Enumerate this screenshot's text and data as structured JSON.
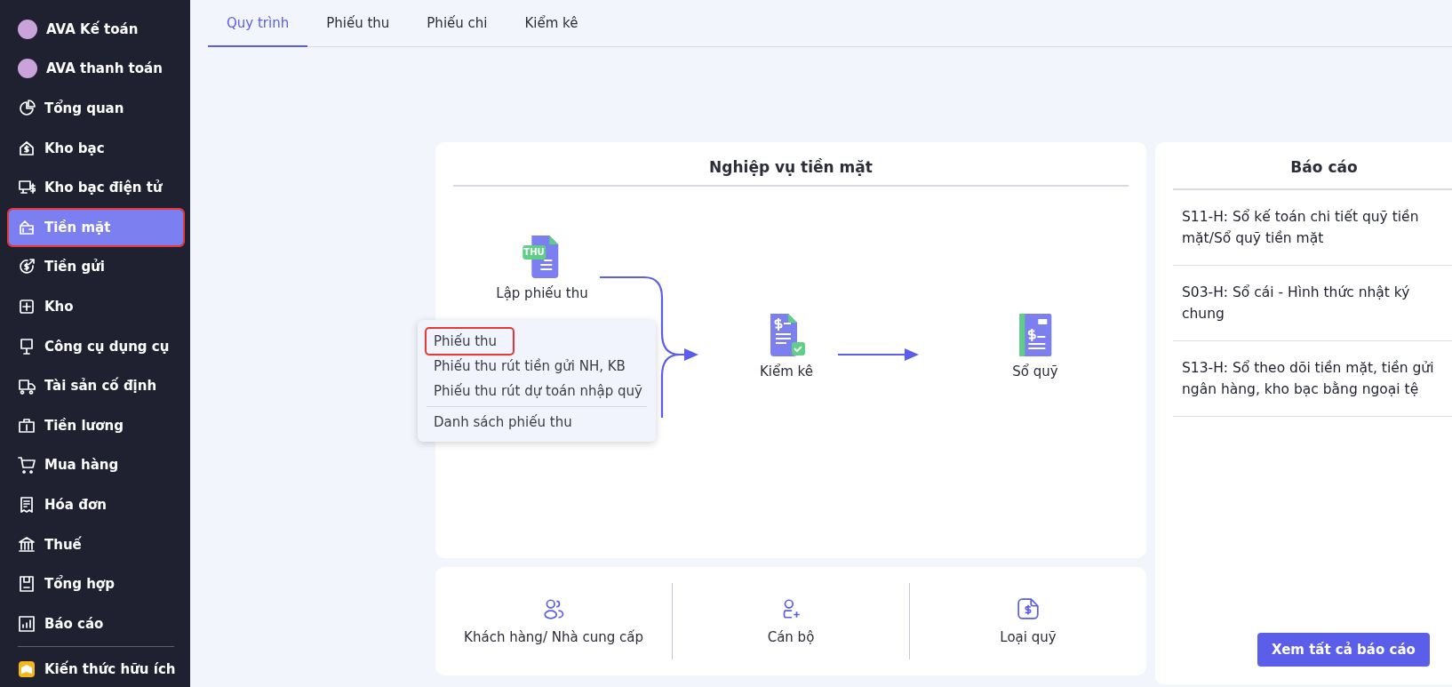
{
  "sidebar": {
    "items": [
      {
        "label": "AVA Kế toán",
        "kind": "avatar",
        "selected": false,
        "highlighted": false
      },
      {
        "label": "AVA thanh toán",
        "kind": "avatar",
        "selected": false,
        "highlighted": false
      },
      {
        "label": "Tổng quan",
        "kind": "icon",
        "selected": false,
        "highlighted": false
      },
      {
        "label": "Kho bạc",
        "kind": "icon",
        "selected": false,
        "highlighted": false
      },
      {
        "label": "Kho bạc điện tử",
        "kind": "icon",
        "selected": false,
        "highlighted": false
      },
      {
        "label": "Tiền mặt",
        "kind": "icon",
        "selected": true,
        "highlighted": true
      },
      {
        "label": "Tiền gửi",
        "kind": "icon",
        "selected": false,
        "highlighted": false
      },
      {
        "label": "Kho",
        "kind": "icon",
        "selected": false,
        "highlighted": false
      },
      {
        "label": "Công cụ dụng cụ",
        "kind": "icon",
        "selected": false,
        "highlighted": false
      },
      {
        "label": "Tài sản cố định",
        "kind": "icon",
        "selected": false,
        "highlighted": false
      },
      {
        "label": "Tiền lương",
        "kind": "icon",
        "selected": false,
        "highlighted": false
      },
      {
        "label": "Mua hàng",
        "kind": "icon",
        "selected": false,
        "highlighted": false
      },
      {
        "label": "Hóa đơn",
        "kind": "icon",
        "selected": false,
        "highlighted": false
      },
      {
        "label": "Thuế",
        "kind": "icon",
        "selected": false,
        "highlighted": false
      },
      {
        "label": "Tổng hợp",
        "kind": "icon",
        "selected": false,
        "highlighted": false
      },
      {
        "label": "Báo cáo",
        "kind": "icon",
        "selected": false,
        "highlighted": false
      },
      {
        "label": "Kiến thức hữu ích",
        "kind": "badge",
        "selected": false,
        "highlighted": false
      }
    ]
  },
  "tabs": [
    {
      "label": "Quy trình",
      "selected": true
    },
    {
      "label": "Phiếu thu",
      "selected": false
    },
    {
      "label": "Phiếu chi",
      "selected": false
    },
    {
      "label": "Kiểm kê",
      "selected": false
    }
  ],
  "process": {
    "title": "Nghiệp vụ tiền mặt",
    "nodes": [
      {
        "label": "Lập phiếu thu",
        "badge": "THU"
      },
      {
        "label": "Kiểm kê"
      },
      {
        "label": "Sổ quỹ"
      }
    ],
    "menu": [
      {
        "label": "Phiếu thu",
        "highlighted": true
      },
      {
        "label": "Phiếu thu rút tiền gửi NH, KB",
        "highlighted": false
      },
      {
        "label": "Phiếu thu rút dự toán nhập quỹ",
        "highlighted": false
      },
      {
        "label": "Danh sách phiếu thu",
        "highlighted": false
      }
    ]
  },
  "shortcuts": [
    "Khách hàng/ Nhà cung cấp",
    "Cán bộ",
    "Loại quỹ"
  ],
  "reports": {
    "title": "Báo cáo",
    "items": [
      "S11-H: Sổ kế toán chi tiết quỹ tiền mặt/Sổ quỹ tiền mặt",
      "S03-H: Sổ cái - Hình thức nhật ký chung",
      "S13-H: Sổ theo dõi tiền mặt, tiền gửi ngân hàng, kho bạc bằng ngoại tệ"
    ],
    "button": "Xem tất cả báo cáo"
  }
}
